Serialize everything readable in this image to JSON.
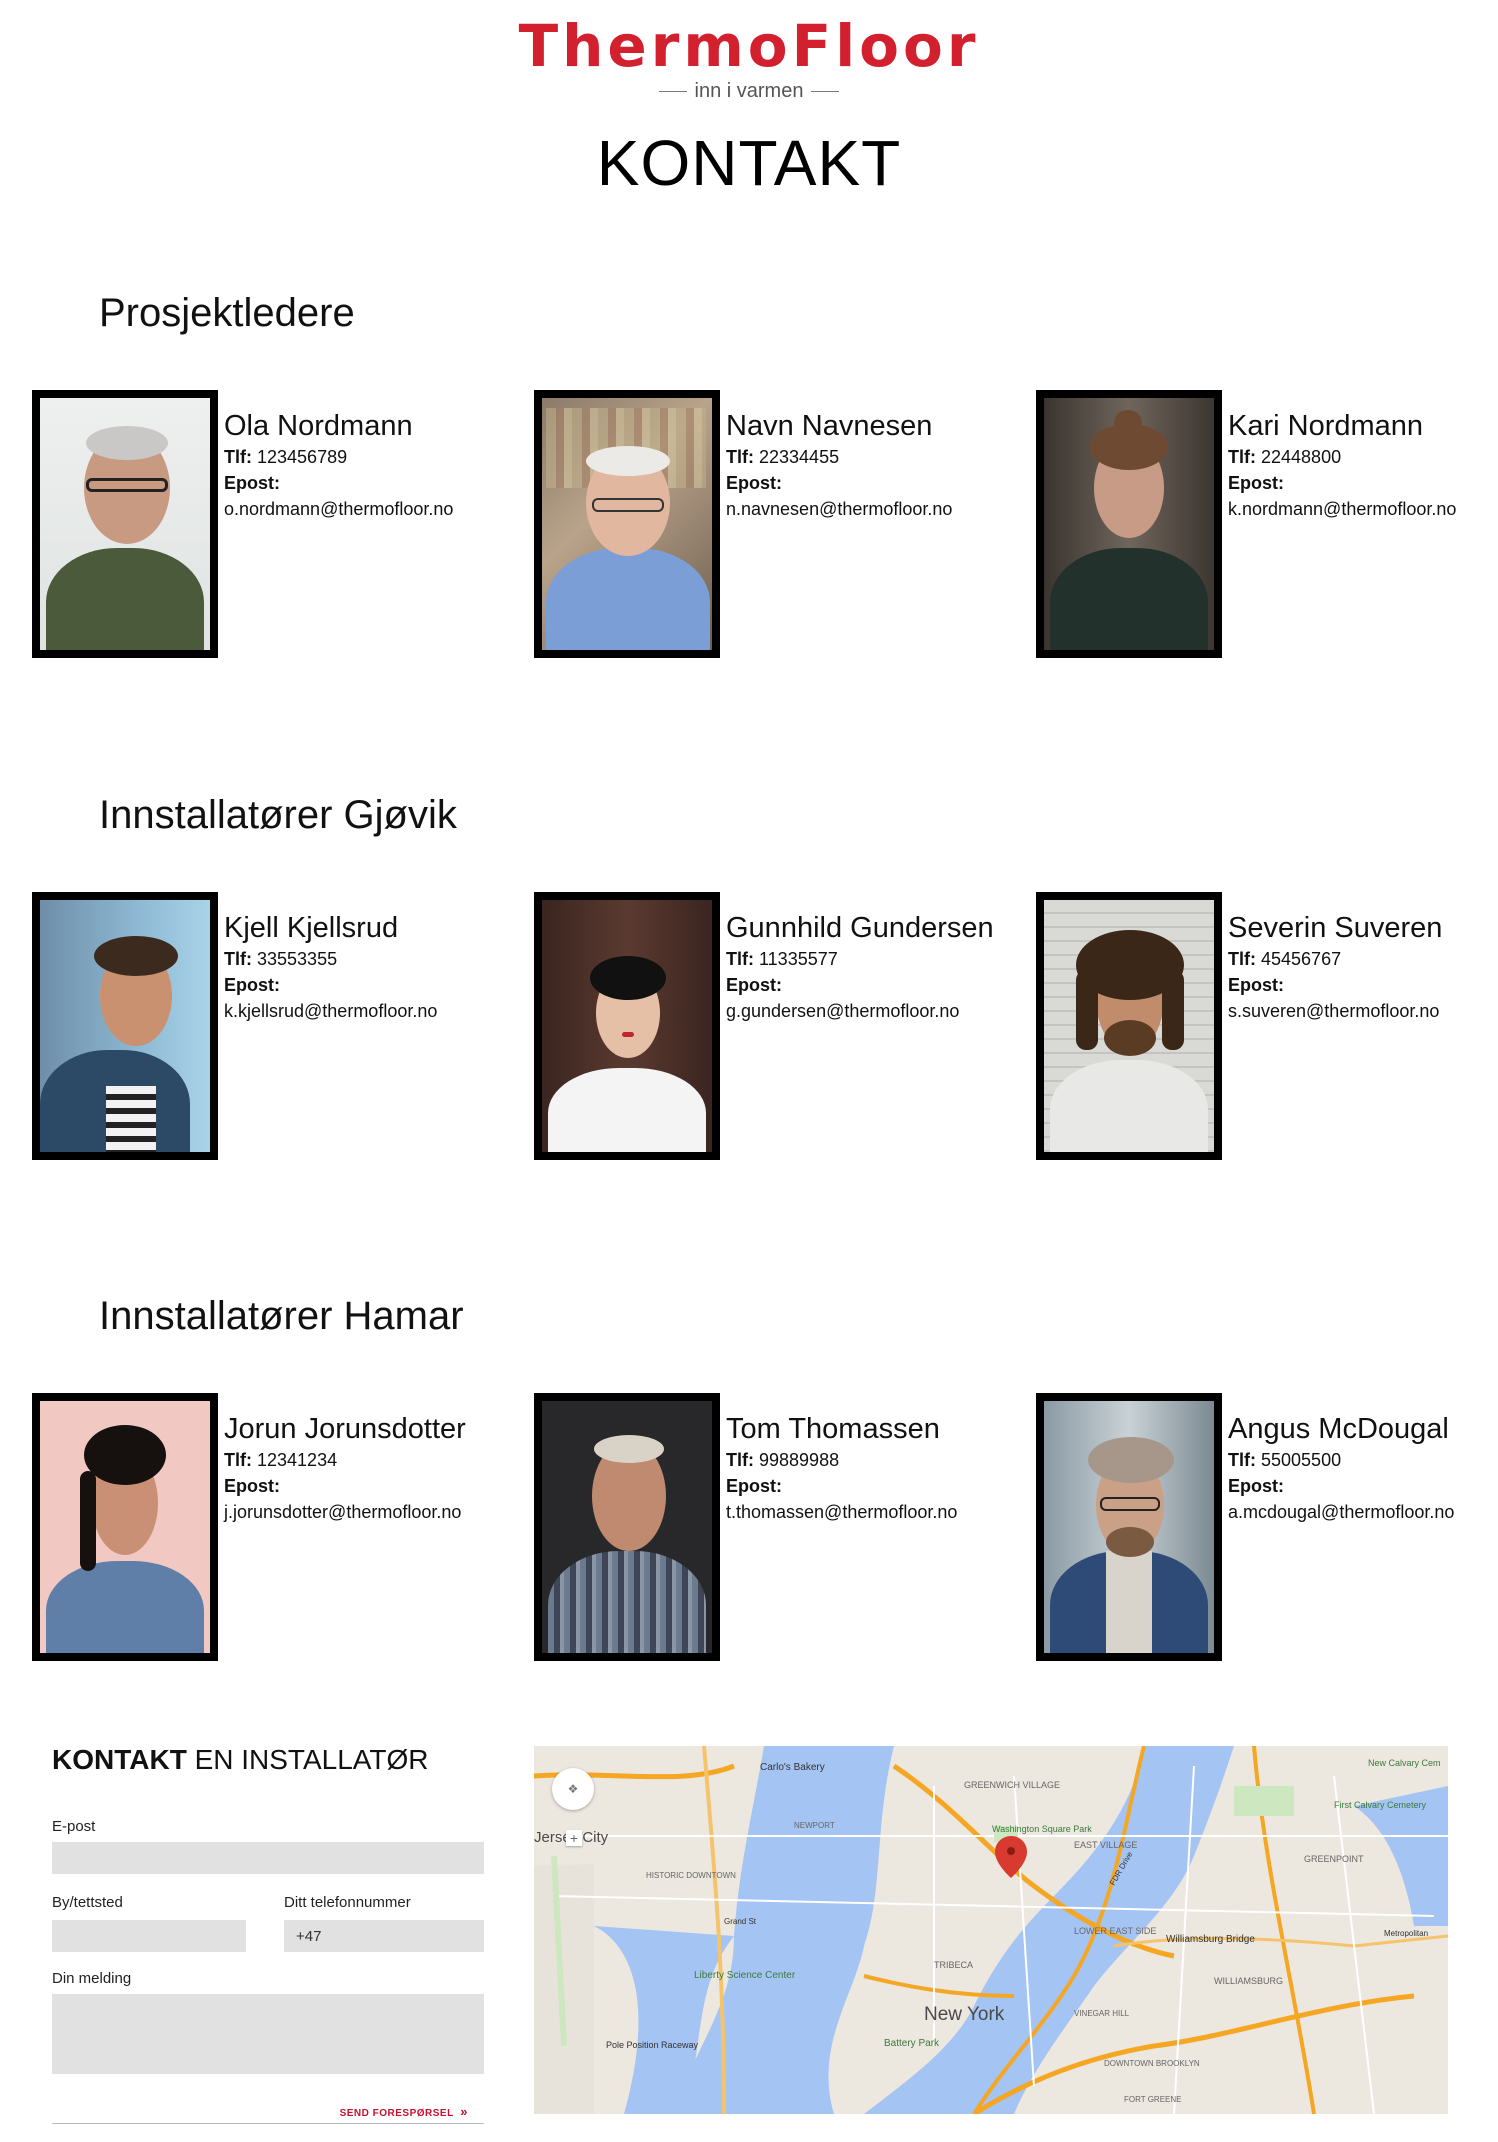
{
  "brand": {
    "name": "ThermoFloor",
    "tagline": "inn i varmen",
    "color": "#d3202f"
  },
  "page_title": "KONTAKT",
  "sections": [
    {
      "title": "Prosjektledere",
      "people": [
        {
          "name": "Ola Nordmann",
          "tlf_label": "Tlf:",
          "tlf": "123456789",
          "epost_label": "Epost:",
          "email": "o.nordmann@thermofloor.no"
        },
        {
          "name": "Navn Navnesen",
          "tlf_label": "Tlf:",
          "tlf": "22334455",
          "epost_label": "Epost:",
          "email": "n.navnesen@thermofloor.no"
        },
        {
          "name": "Kari Nordmann",
          "tlf_label": "Tlf:",
          "tlf": "22448800",
          "epost_label": "Epost:",
          "email": "k.nordmann@thermofloor.no"
        }
      ]
    },
    {
      "title": "Innstallatører Gjøvik",
      "people": [
        {
          "name": "Kjell Kjellsrud",
          "tlf_label": "Tlf:",
          "tlf": "33553355",
          "epost_label": "Epost:",
          "email": "k.kjellsrud@thermofloor.no"
        },
        {
          "name": "Gunnhild Gundersen",
          "tlf_label": "Tlf:",
          "tlf": "11335577",
          "epost_label": "Epost:",
          "email": "g.gundersen@thermofloor.no"
        },
        {
          "name": "Severin Suveren",
          "tlf_label": "Tlf:",
          "tlf": "45456767",
          "epost_label": "Epost:",
          "email": "s.suveren@thermofloor.no"
        }
      ]
    },
    {
      "title": "Innstallatører Hamar",
      "people": [
        {
          "name": "Jorun Jorunsdotter",
          "tlf_label": "Tlf:",
          "tlf": "12341234",
          "epost_label": "Epost:",
          "email": "j.jorunsdotter@thermofloor.no"
        },
        {
          "name": "Tom Thomassen",
          "tlf_label": "Tlf:",
          "tlf": "99889988",
          "epost_label": "Epost:",
          "email": "t.thomassen@thermofloor.no"
        },
        {
          "name": "Angus McDougal",
          "tlf_label": "Tlf:",
          "tlf": "55005500",
          "epost_label": "Epost:",
          "email": "a.mcdougal@thermofloor.no"
        }
      ]
    }
  ],
  "contact_form": {
    "title_bold": "KONTAKT",
    "title_rest": " EN INSTALLATØR",
    "email_label": "E-post",
    "city_label": "By/tettsted",
    "phone_label": "Ditt telefonnummer",
    "phone_value": "+47",
    "message_label": "Din melding",
    "send_label": "SEND FORESPØRSEL",
    "send_icon": "double-chevron-right-icon"
  },
  "map": {
    "labels": {
      "new_york": "New York",
      "jersey_city": "Jersey City",
      "washington_square_park": "Washington Square Park",
      "east_village": "EAST VILLAGE",
      "lower_east_side": "LOWER EAST SIDE",
      "tribeca": "TRIBECA",
      "battery_park": "Battery Park",
      "liberty_science_center": "Liberty Science Center",
      "williamsburg_bridge": "Williamsburg Bridge",
      "williamsburg": "WILLIAMSBURG",
      "greenwich_village": "GREENWICH VILLAGE",
      "greenpoint": "GREENPOINT",
      "first_calvary_cemetery": "First Calvary Cemetery",
      "new_calvary_cemetery": "New Calvary Cem",
      "carlos_bakery": "Carlo's Bakery",
      "historic_downtown": "HISTORIC DOWNTOWN",
      "newport": "NEWPORT",
      "vinegar_hill": "VINEGAR HILL",
      "downtown_brooklyn": "DOWNTOWN BROOKLYN",
      "fort_greene": "FORT GREENE",
      "pole_position_raceway": "Pole Position Raceway",
      "metropolitan": "Metropolitan",
      "fdr_drive": "FDR Drive",
      "grand_st": "Grand St"
    },
    "marker_icon": "map-pin-icon",
    "pan_icon": "pan-control-icon",
    "zoom_in_icon": "zoom-in-icon"
  }
}
